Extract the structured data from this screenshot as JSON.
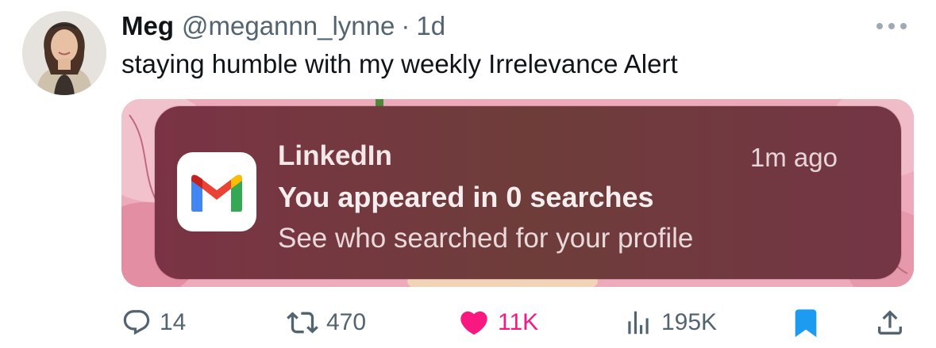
{
  "tweet": {
    "display_name": "Meg",
    "handle": "@megannn_lynne",
    "separator": "·",
    "time": "1d",
    "text": "staying humble with my weekly Irrelevance Alert"
  },
  "notification": {
    "app": "LinkedIn",
    "time": "1m ago",
    "title": "You appeared in 0 searches",
    "body": "See who searched for your profile",
    "icon": "gmail-icon"
  },
  "actions": {
    "replies": "14",
    "reposts": "470",
    "likes": "11K",
    "views": "195K"
  },
  "icons": {
    "more": "more-icon",
    "reply": "reply-icon",
    "repost": "repost-icon",
    "like": "heart-icon",
    "views": "views-icon",
    "bookmark": "bookmark-icon",
    "share": "share-icon"
  },
  "colors": {
    "like_active": "#f91880",
    "bookmark_active": "#1d9bf0",
    "secondary_text": "#536471",
    "primary_text": "#0f1419"
  }
}
